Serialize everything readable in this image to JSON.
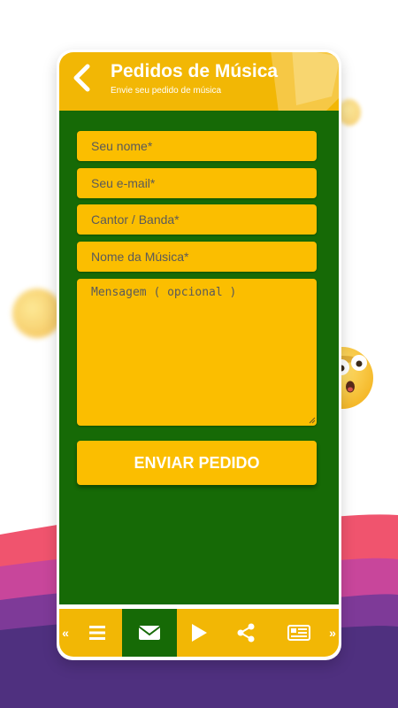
{
  "header": {
    "title": "Pedidos de Música",
    "subtitle": "Envie seu pedido de música"
  },
  "form": {
    "name_placeholder": "Seu nome*",
    "email_placeholder": "Seu e-mail*",
    "artist_placeholder": "Cantor / Banda*",
    "song_placeholder": "Nome da Música*",
    "message_placeholder": "Mensagem ( opcional )",
    "submit_label": "ENVIAR PEDIDO"
  },
  "nav": {
    "prev_arrow": "«",
    "next_arrow": "»",
    "items": [
      {
        "icon": "menu-icon",
        "active": false
      },
      {
        "icon": "envelope-icon",
        "active": true
      },
      {
        "icon": "play-icon",
        "active": false
      },
      {
        "icon": "share-icon",
        "active": false
      },
      {
        "icon": "news-icon",
        "active": false
      }
    ]
  },
  "colors": {
    "accent": "#f2b705",
    "field": "#fbbe00",
    "content_bg": "#166a06",
    "text_white": "#ffffff"
  }
}
